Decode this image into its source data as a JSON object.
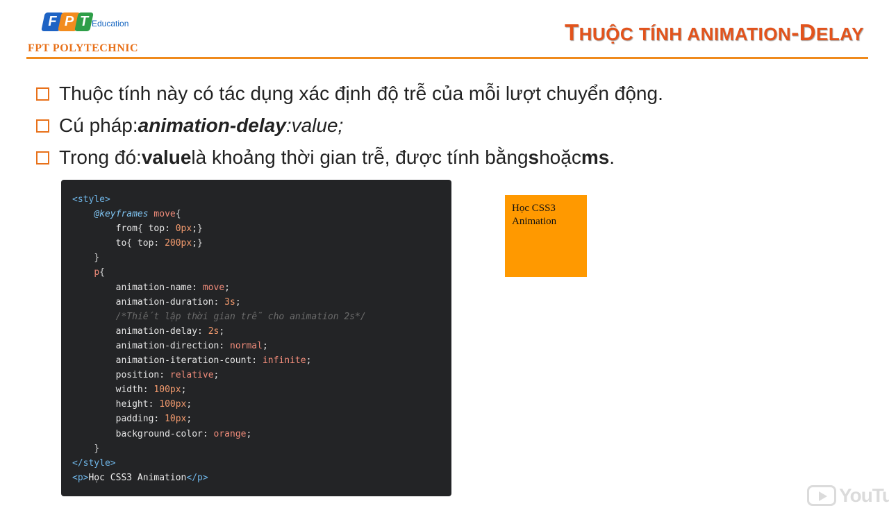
{
  "header": {
    "logo_letters": [
      "F",
      "P",
      "T"
    ],
    "logo_colors": [
      "#1e63c4",
      "#f28c1e",
      "#2e9e48"
    ],
    "logo_subtitle": "Education",
    "org_name": "FPT POLYTECHNIC",
    "title_parts": [
      {
        "text": "T",
        "size": "big"
      },
      {
        "text": "HUỘC TÍNH ANIMATION",
        "size": "small"
      },
      {
        "text": "-D",
        "size": "big"
      },
      {
        "text": "ELAY",
        "size": "small"
      }
    ],
    "accent_color": "#e8711a"
  },
  "bullets": [
    [
      {
        "text": "Thuộc tính này có tác dụng xác định độ trễ của mỗi lượt chuyển động.",
        "style": ""
      }
    ],
    [
      {
        "text": "Cú pháp: ",
        "style": ""
      },
      {
        "text": "animation-delay",
        "style": "bi"
      },
      {
        "text": ": ",
        "style": "i"
      },
      {
        "text": "value;",
        "style": "i"
      }
    ],
    [
      {
        "text": "Trong đó: ",
        "style": ""
      },
      {
        "text": "value",
        "style": "b"
      },
      {
        "text": " là khoảng thời gian trễ, được tính bằng ",
        "style": ""
      },
      {
        "text": "s",
        "style": "b"
      },
      {
        "text": " hoặc ",
        "style": ""
      },
      {
        "text": "ms",
        "style": "b"
      },
      {
        "text": ".",
        "style": ""
      }
    ]
  ],
  "code": {
    "lines": [
      [
        [
          "tag",
          "<style>"
        ]
      ],
      [
        [
          "text",
          "    "
        ],
        [
          "key",
          "@keyframes"
        ],
        [
          "text",
          " "
        ],
        [
          "name",
          "move"
        ],
        [
          "brace",
          "{"
        ]
      ],
      [
        [
          "text",
          "        "
        ],
        [
          "prop",
          "from"
        ],
        [
          "brace",
          "{"
        ],
        [
          "prop",
          " top: "
        ],
        [
          "num",
          "0px"
        ],
        [
          "punc",
          ";"
        ],
        [
          "brace",
          "}"
        ]
      ],
      [
        [
          "text",
          "        "
        ],
        [
          "prop",
          "to"
        ],
        [
          "brace",
          "{"
        ],
        [
          "prop",
          " top: "
        ],
        [
          "num",
          "200px"
        ],
        [
          "punc",
          ";"
        ],
        [
          "brace",
          "}"
        ]
      ],
      [
        [
          "text",
          "    "
        ],
        [
          "brace",
          "}"
        ]
      ],
      [
        [
          "text",
          "    "
        ],
        [
          "sel",
          "p"
        ],
        [
          "brace",
          "{"
        ]
      ],
      [
        [
          "text",
          "        "
        ],
        [
          "prop",
          "animation-name: "
        ],
        [
          "val",
          "move"
        ],
        [
          "punc",
          ";"
        ]
      ],
      [
        [
          "text",
          "        "
        ],
        [
          "prop",
          "animation-duration: "
        ],
        [
          "num",
          "3s"
        ],
        [
          "punc",
          ";"
        ]
      ],
      [
        [
          "text",
          "        "
        ],
        [
          "comment",
          "/*Thiết lập thời gian trễ cho animation 2s*/"
        ]
      ],
      [
        [
          "text",
          "        "
        ],
        [
          "prop",
          "animation-delay: "
        ],
        [
          "num",
          "2s"
        ],
        [
          "punc",
          ";"
        ]
      ],
      [
        [
          "text",
          "        "
        ],
        [
          "prop",
          "animation-direction: "
        ],
        [
          "val",
          "normal"
        ],
        [
          "punc",
          ";"
        ]
      ],
      [
        [
          "text",
          "        "
        ],
        [
          "prop",
          "animation-iteration-count: "
        ],
        [
          "val",
          "infinite"
        ],
        [
          "punc",
          ";"
        ]
      ],
      [
        [
          "text",
          "        "
        ],
        [
          "prop",
          "position: "
        ],
        [
          "val",
          "relative"
        ],
        [
          "punc",
          ";"
        ]
      ],
      [
        [
          "text",
          "        "
        ],
        [
          "prop",
          "width: "
        ],
        [
          "num",
          "100px"
        ],
        [
          "punc",
          ";"
        ]
      ],
      [
        [
          "text",
          "        "
        ],
        [
          "prop",
          "height: "
        ],
        [
          "num",
          "100px"
        ],
        [
          "punc",
          ";"
        ]
      ],
      [
        [
          "text",
          "        "
        ],
        [
          "prop",
          "padding: "
        ],
        [
          "num",
          "10px"
        ],
        [
          "punc",
          ";"
        ]
      ],
      [
        [
          "text",
          "        "
        ],
        [
          "prop",
          "background-color: "
        ],
        [
          "val",
          "orange"
        ],
        [
          "punc",
          ";"
        ]
      ],
      [
        [
          "text",
          "    "
        ],
        [
          "brace",
          "}"
        ]
      ],
      [
        [
          "tag",
          "</style>"
        ]
      ],
      [
        [
          "tag",
          "<p>"
        ],
        [
          "text",
          "Học CSS3 Animation"
        ],
        [
          "tag",
          "</p>"
        ]
      ]
    ]
  },
  "demo": {
    "text": "Học CSS3 Animation",
    "color": "#ff9900"
  },
  "watermark": {
    "text": "YouTub"
  }
}
